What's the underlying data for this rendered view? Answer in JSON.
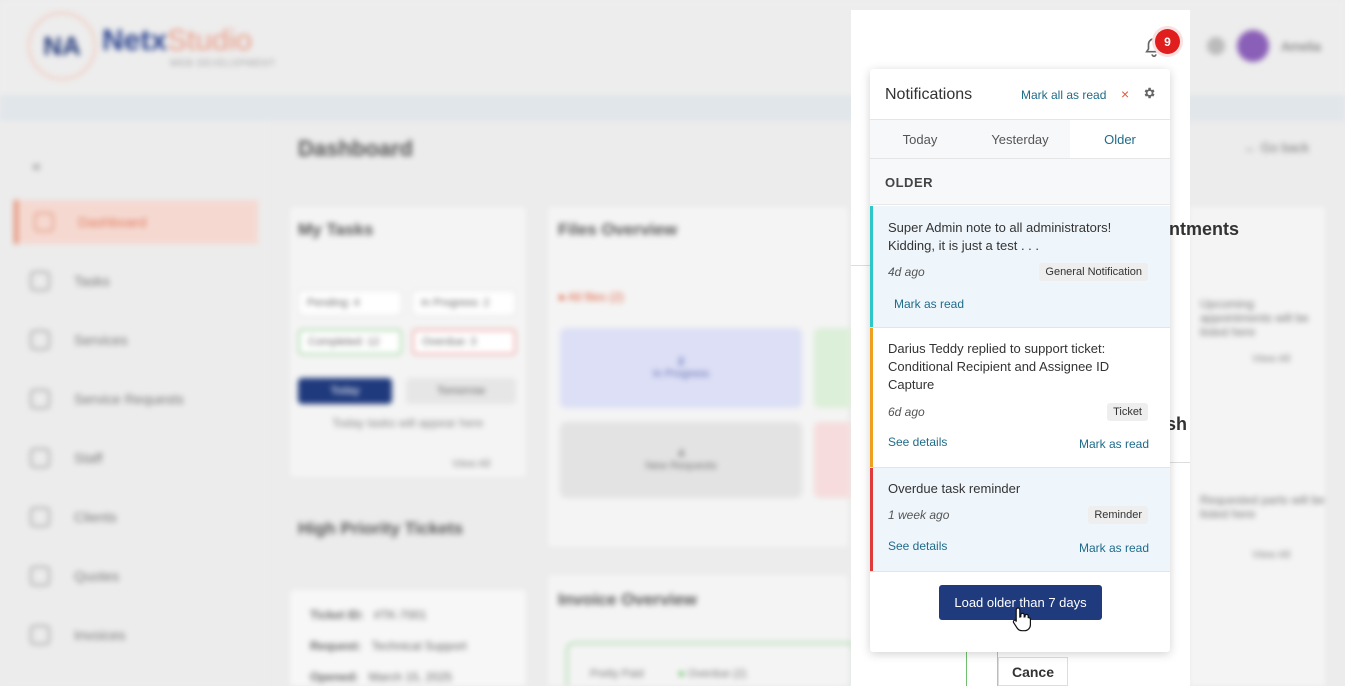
{
  "background": {
    "logo": {
      "mark": "NA",
      "name_a": "Netx",
      "name_b": "Studio",
      "tagline": "WEB DEVELOPMENT"
    },
    "user_name": "Amelia",
    "page_title": "Dashboard",
    "go_back": "Go back",
    "sidebar": [
      {
        "label": "Dashboard",
        "icon": "dashboard-icon"
      },
      {
        "label": "Tasks",
        "icon": "tasks-icon"
      },
      {
        "label": "Services",
        "icon": "services-icon"
      },
      {
        "label": "Service Requests",
        "icon": "service-requests-icon"
      },
      {
        "label": "Staff",
        "icon": "staff-icon"
      },
      {
        "label": "Clients",
        "icon": "clients-icon"
      },
      {
        "label": "Quotes",
        "icon": "quotes-icon"
      },
      {
        "label": "Invoices",
        "icon": "invoices-icon"
      }
    ],
    "cards": {
      "my_tasks": "My Tasks",
      "files_overview": "Files Overview",
      "high_priority": "High Priority Tickets",
      "invoice_overview": "Invoice Overview",
      "appointments_partial": "intments",
      "push_partial": "sh",
      "task_pills": [
        "Pending: 4",
        "In Progress: 2",
        "Completed: 12",
        "Overdue: 3"
      ],
      "today_btn": "Today",
      "tomorrow_btn": "Tomorrow",
      "today_text": "Today tasks will appear here",
      "view_all": "View All",
      "files_alert": "All files (2)",
      "stats": [
        {
          "count": "2",
          "label": "In Progress"
        },
        {
          "count": "4",
          "label": "New Requests"
        }
      ],
      "ticket_rows": [
        {
          "k": "Ticket ID:",
          "v": "#TK-7001"
        },
        {
          "k": "Request:",
          "v": "Technical Support"
        },
        {
          "k": "Opened:",
          "v": "March 15, 2025"
        }
      ],
      "appointments_text": "Upcoming appointments will be listed here",
      "requests_text": "Requested parts will be listed here",
      "invoice_item": "Pretty Paid",
      "invoice_status": "Overdue (2)"
    },
    "cancel_button": "Cance"
  },
  "header": {
    "notification_count": "9"
  },
  "notifications": {
    "title": "Notifications",
    "mark_all": "Mark all as read",
    "close": "×",
    "tabs": [
      {
        "label": "Today",
        "active": false
      },
      {
        "label": "Yesterday",
        "active": false
      },
      {
        "label": "Older",
        "active": true
      }
    ],
    "section": "OLDER",
    "items": [
      {
        "text": "Super Admin note to all administrators! Kidding, it is just a test . . .",
        "ago": "4d ago",
        "tag": "General Notification",
        "mark": "Mark as read",
        "accent": "#2ec7c9",
        "bg": "#eef6fc"
      },
      {
        "text": "Darius Teddy replied to support ticket: Conditional Recipient and Assignee ID Capture",
        "ago": "6d ago",
        "tag": "Ticket",
        "details": "See details",
        "mark": "Mark as read",
        "accent": "#f0a020",
        "bg": "#ffffff"
      },
      {
        "text": "Overdue task reminder",
        "ago": "1 week ago",
        "tag": "Reminder",
        "details": "See details",
        "mark": "Mark as read",
        "accent": "#e03b3b",
        "bg": "#eef6fc"
      }
    ],
    "load_older": "Load older than 7 days"
  }
}
